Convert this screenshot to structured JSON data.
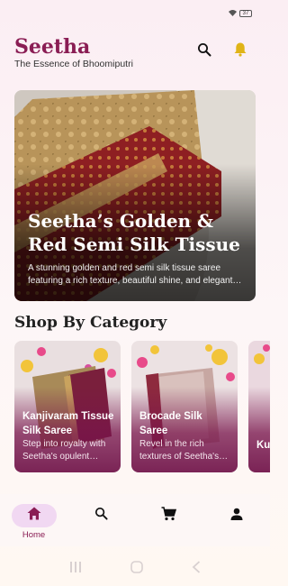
{
  "status_bar": {
    "battery": "37"
  },
  "header": {
    "brand": "Seetha",
    "tagline": "The Essence of Bhoomiputri",
    "icons": [
      "search-icon",
      "bell-icon"
    ]
  },
  "hero": {
    "title": "Seetha’s Golden & Red Semi Silk Tissue Saree",
    "description": "A stunning golden and red semi silk tissue saree featuring a rich texture, beautiful shine, and elegant design."
  },
  "section": {
    "title": "Shop By Category"
  },
  "categories": [
    {
      "title": "Kanjivaram Tissue Silk Saree",
      "description": "Step into royalty with Seetha's opulent Kanjivaram silk."
    },
    {
      "title": "Brocade Silk Saree",
      "description": "Revel in the rich textures of Seetha's brocade."
    },
    {
      "title": "Ku",
      "description": ""
    }
  ],
  "bottom_nav": {
    "items": [
      {
        "icon": "home-icon",
        "label": "Home",
        "active": true
      },
      {
        "icon": "search-icon",
        "label": ""
      },
      {
        "icon": "cart-icon",
        "label": ""
      },
      {
        "icon": "profile-icon",
        "label": ""
      }
    ]
  },
  "colors": {
    "brand": "#8a1d54",
    "bell": "#e0b417",
    "active_pill": "#f1d8f2"
  }
}
